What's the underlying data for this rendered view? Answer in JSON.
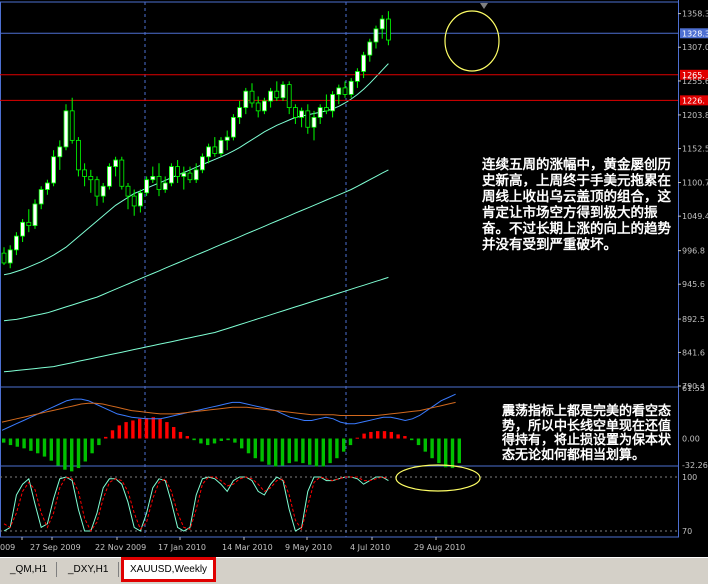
{
  "chart_data": {
    "type": "candlestick",
    "symbol": "XAUUSD",
    "timeframe": "Weekly",
    "price_axis": {
      "range": [
        790.4,
        1376
      ],
      "ticks": [
        "1358.3",
        "1307.0",
        "1255.6",
        "1203.8",
        "1152.5",
        "1100.7",
        "1049.4",
        "996.8",
        "945.6",
        "892.5",
        "841.6",
        "790.4"
      ],
      "current_price": "1328.3"
    },
    "horizontal_lines": [
      {
        "price": 1328.3,
        "color": "#4d6fd1"
      },
      {
        "price": 1265,
        "color": "#e00000",
        "label": "1265."
      },
      {
        "price": 1226,
        "color": "#e00000",
        "label": "1226."
      }
    ],
    "candles": [
      [
        993,
        1002,
        975,
        978
      ],
      [
        978,
        1005,
        970,
        998
      ],
      [
        998,
        1025,
        990,
        1019
      ],
      [
        1019,
        1045,
        1010,
        1040
      ],
      [
        1040,
        1060,
        1025,
        1035
      ],
      [
        1035,
        1075,
        1030,
        1068
      ],
      [
        1068,
        1095,
        1060,
        1090
      ],
      [
        1090,
        1105,
        1082,
        1100
      ],
      [
        1100,
        1150,
        1095,
        1140
      ],
      [
        1140,
        1165,
        1120,
        1155
      ],
      [
        1155,
        1220,
        1150,
        1210
      ],
      [
        1210,
        1230,
        1160,
        1165
      ],
      [
        1165,
        1170,
        1110,
        1120
      ],
      [
        1120,
        1130,
        1095,
        1110
      ],
      [
        1110,
        1120,
        1085,
        1105
      ],
      [
        1105,
        1110,
        1065,
        1080
      ],
      [
        1080,
        1100,
        1070,
        1095
      ],
      [
        1095,
        1130,
        1090,
        1125
      ],
      [
        1125,
        1140,
        1110,
        1135
      ],
      [
        1135,
        1140,
        1090,
        1095
      ],
      [
        1095,
        1100,
        1060,
        1080
      ],
      [
        1080,
        1090,
        1050,
        1065
      ],
      [
        1065,
        1090,
        1055,
        1085
      ],
      [
        1085,
        1110,
        1080,
        1105
      ],
      [
        1105,
        1125,
        1100,
        1110
      ],
      [
        1110,
        1130,
        1080,
        1090
      ],
      [
        1090,
        1110,
        1085,
        1100
      ],
      [
        1100,
        1130,
        1095,
        1125
      ],
      [
        1125,
        1135,
        1100,
        1110
      ],
      [
        1110,
        1125,
        1090,
        1115
      ],
      [
        1115,
        1125,
        1100,
        1105
      ],
      [
        1105,
        1130,
        1100,
        1120
      ],
      [
        1120,
        1145,
        1115,
        1140
      ],
      [
        1140,
        1160,
        1130,
        1155
      ],
      [
        1155,
        1170,
        1140,
        1145
      ],
      [
        1145,
        1170,
        1140,
        1165
      ],
      [
        1165,
        1180,
        1150,
        1170
      ],
      [
        1170,
        1205,
        1165,
        1200
      ],
      [
        1200,
        1225,
        1190,
        1215
      ],
      [
        1215,
        1245,
        1205,
        1240
      ],
      [
        1240,
        1252,
        1215,
        1222
      ],
      [
        1222,
        1232,
        1200,
        1210
      ],
      [
        1210,
        1230,
        1205,
        1225
      ],
      [
        1225,
        1245,
        1215,
        1240
      ],
      [
        1240,
        1255,
        1225,
        1230
      ],
      [
        1230,
        1255,
        1225,
        1250
      ],
      [
        1250,
        1255,
        1205,
        1215
      ],
      [
        1215,
        1220,
        1190,
        1200
      ],
      [
        1200,
        1215,
        1185,
        1210
      ],
      [
        1210,
        1220,
        1175,
        1185
      ],
      [
        1185,
        1210,
        1165,
        1200
      ],
      [
        1200,
        1220,
        1190,
        1215
      ],
      [
        1215,
        1235,
        1205,
        1210
      ],
      [
        1210,
        1240,
        1200,
        1235
      ],
      [
        1235,
        1250,
        1220,
        1245
      ],
      [
        1245,
        1255,
        1230,
        1235
      ],
      [
        1235,
        1260,
        1230,
        1255
      ],
      [
        1255,
        1275,
        1245,
        1270
      ],
      [
        1270,
        1300,
        1260,
        1295
      ],
      [
        1295,
        1320,
        1285,
        1315
      ],
      [
        1315,
        1340,
        1305,
        1335
      ],
      [
        1335,
        1356,
        1320,
        1350
      ],
      [
        1350,
        1362,
        1310,
        1318
      ]
    ],
    "ma_series": [
      {
        "color": "#7fffd4",
        "values": [
          960,
          962,
          965,
          968,
          972,
          976,
          980,
          985,
          990,
          996,
          1002,
          1010,
          1018,
          1026,
          1034,
          1042,
          1050,
          1058,
          1066,
          1072,
          1078,
          1084,
          1088,
          1092,
          1096,
          1100,
          1104,
          1108,
          1112,
          1116,
          1120,
          1124,
          1128,
          1132,
          1136,
          1140,
          1144,
          1149,
          1154,
          1160,
          1166,
          1172,
          1178,
          1183,
          1188,
          1192,
          1196,
          1200,
          1202,
          1204,
          1206,
          1208,
          1210,
          1213,
          1217,
          1222,
          1228,
          1235,
          1243,
          1252,
          1262,
          1272,
          1282
        ]
      },
      {
        "color": "#7fffd4",
        "values": [
          890,
          891,
          892,
          894,
          896,
          898,
          900,
          902,
          905,
          908,
          911,
          914,
          917,
          920,
          923,
          926,
          930,
          934,
          938,
          942,
          946,
          950,
          954,
          958,
          962,
          966,
          970,
          974,
          978,
          982,
          986,
          990,
          994,
          998,
          1002,
          1006,
          1010,
          1014,
          1018,
          1022,
          1026,
          1030,
          1034,
          1038,
          1042,
          1046,
          1050,
          1054,
          1058,
          1062,
          1066,
          1070,
          1074,
          1078,
          1082,
          1086,
          1090,
          1095,
          1100,
          1105,
          1110,
          1115,
          1120
        ]
      },
      {
        "color": "#7fffd4",
        "values": [
          812,
          813,
          814,
          815,
          816,
          817,
          818,
          819,
          820,
          822,
          824,
          826,
          828,
          830,
          832,
          834,
          836,
          838,
          840,
          842,
          844,
          846,
          848,
          850,
          852,
          854,
          856,
          858,
          860,
          862,
          864,
          866,
          868,
          870,
          872,
          875,
          878,
          881,
          884,
          887,
          890,
          893,
          896,
          899,
          902,
          905,
          908,
          911,
          914,
          917,
          920,
          923,
          926,
          929,
          932,
          935,
          938,
          941,
          944,
          947,
          950,
          953,
          956
        ]
      }
    ],
    "oscillator": {
      "range": [
        -32.26,
        61.53
      ],
      "ticks": [
        "61.53",
        "0.00",
        "-32.26"
      ],
      "histogram": [
        -5,
        -8,
        -10,
        -12,
        -15,
        -18,
        -22,
        -27,
        -33,
        -38,
        -40,
        -36,
        -28,
        -18,
        -8,
        2,
        10,
        16,
        20,
        22,
        24,
        25,
        26,
        24,
        20,
        14,
        8,
        3,
        -2,
        -6,
        -8,
        -6,
        -3,
        -2,
        -5,
        -12,
        -18,
        -24,
        -28,
        -32,
        -34,
        -33,
        -30,
        -28,
        -30,
        -32,
        -34,
        -34,
        -30,
        -24,
        -16,
        -8,
        1,
        6,
        8,
        9,
        9,
        8,
        5,
        3,
        -2,
        -8,
        -16,
        -24,
        -30,
        -35,
        -36,
        -30
      ],
      "line_blue": [
        10,
        14,
        18,
        22,
        26,
        30,
        34,
        38,
        42,
        46,
        48,
        48,
        46,
        42,
        38,
        34,
        30,
        28,
        26,
        25,
        24,
        24,
        24,
        26,
        28,
        30,
        32,
        34,
        36,
        38,
        40,
        42,
        44,
        44,
        42,
        40,
        38,
        36,
        34,
        30,
        26,
        24,
        22,
        22,
        24,
        26,
        24,
        20,
        18,
        18,
        20,
        22,
        24,
        26,
        26,
        24,
        22,
        24,
        28,
        34,
        40,
        46,
        50,
        54
      ],
      "line_orange": [
        20,
        22,
        24,
        26,
        28,
        30,
        32,
        34,
        36,
        38,
        40,
        42,
        43,
        43,
        42,
        40,
        38,
        36,
        34,
        33,
        32,
        31,
        30,
        30,
        30,
        31,
        32,
        33,
        34,
        35,
        36,
        37,
        38,
        38,
        38,
        37,
        36,
        35,
        34,
        33,
        32,
        31,
        30,
        29,
        29,
        29,
        29,
        28,
        28,
        28,
        28,
        28,
        28,
        29,
        30,
        31,
        32,
        33,
        34,
        36,
        38,
        40,
        42,
        44
      ]
    },
    "stochastic": {
      "levels": [
        "100",
        "70"
      ],
      "main": [
        70,
        72,
        90,
        96,
        99,
        85,
        72,
        74,
        88,
        99,
        100,
        98,
        82,
        70,
        70,
        80,
        94,
        99,
        99,
        96,
        86,
        72,
        70,
        80,
        94,
        99,
        98,
        86,
        72,
        70,
        72,
        90,
        99,
        100,
        99,
        96,
        92,
        98,
        100,
        100,
        98,
        92,
        90,
        96,
        100,
        98,
        82,
        70,
        72,
        92,
        100,
        100,
        98,
        98,
        99,
        100,
        100,
        99,
        96,
        98,
        100,
        100,
        98
      ],
      "signal": [
        74,
        72,
        80,
        92,
        97,
        93,
        80,
        72,
        80,
        94,
        100,
        99,
        92,
        77,
        70,
        75,
        88,
        97,
        99,
        98,
        92,
        80,
        71,
        75,
        88,
        97,
        99,
        92,
        80,
        72,
        71,
        82,
        96,
        100,
        100,
        98,
        95,
        96,
        99,
        100,
        99,
        96,
        92,
        94,
        98,
        99,
        90,
        76,
        71,
        84,
        97,
        100,
        99,
        98,
        99,
        100,
        100,
        100,
        98,
        98,
        99,
        100,
        99
      ]
    },
    "x_labels": [
      "009",
      "27 Sep 2009",
      "22 Nov 2009",
      "17 Jan 2010",
      "14 Mar 2010",
      "9 May 2010",
      "4 Jul 2010",
      "29 Aug 2010"
    ]
  },
  "annotations": {
    "main": "连续五周的涨幅中，黄金屡创历史新高，上周终于手美元拖累在周线上收出乌云盖顶的组合，这肯定让市场空方得到极大的振奋。不过长期上涨的向上的趋势并没有受到严重破坏。",
    "oscillator": "震荡指标上都是完美的看空态势，所以中长线空单现在还值得持有，将止损设置为保本状态无论如何都相当划算。"
  },
  "colors": {
    "background": "#000000",
    "frame": "#4d6fd1",
    "grid_separator": "#4d6fd1",
    "bull_body": "#ffffff",
    "bear_body": "#000000",
    "candle_wick": "#00ff00",
    "resistance_line": "#e00000",
    "histogram_up": "#ff0000",
    "histogram_down": "#00c000",
    "stoch_main": "#7fffd4",
    "stoch_signal": "#ff0000",
    "highlight": "#ffff66"
  },
  "tabs": [
    {
      "label": "_QM,H1",
      "active": false
    },
    {
      "label": "_DXY,H1",
      "active": false
    },
    {
      "label": "XAUUSD,Weekly",
      "active": true
    }
  ]
}
